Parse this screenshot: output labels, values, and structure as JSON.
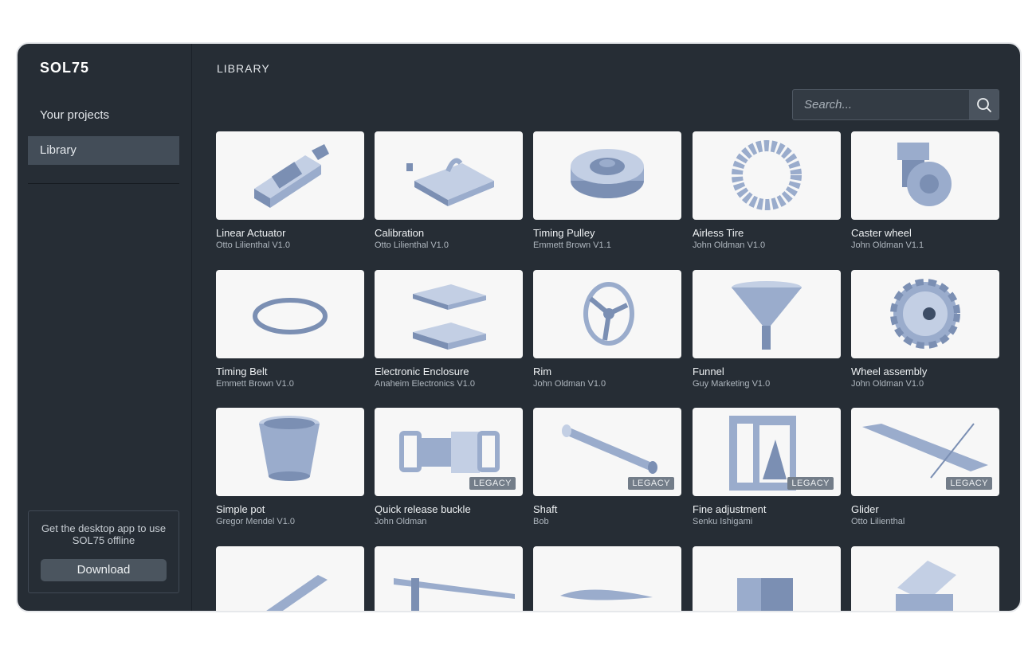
{
  "app": {
    "logo_text": "SOL75",
    "page_title": "LIBRARY",
    "colors": {
      "frame": "#262d35",
      "card": "#f7f7f7",
      "part": "#9aaccc",
      "active_nav": "#434d58",
      "badge": "#737d89"
    }
  },
  "sidebar": {
    "items": [
      {
        "label": "Your projects",
        "active": false
      },
      {
        "label": "Library",
        "active": true
      }
    ],
    "promo": {
      "text": "Get the desktop app to use SOL75 offline",
      "button": "Download"
    }
  },
  "search": {
    "placeholder": "Search...",
    "icon": "magnifier-icon"
  },
  "cards": [
    {
      "title": "Linear Actuator",
      "subtitle": "Otto Lilienthal V1.0",
      "legacy": "",
      "icon": "linear-actuator"
    },
    {
      "title": "Calibration",
      "subtitle": "Otto Lilienthal V1.0",
      "legacy": "",
      "icon": "calibration"
    },
    {
      "title": "Timing Pulley",
      "subtitle": "Emmett Brown V1.1",
      "legacy": "",
      "icon": "timing-pulley"
    },
    {
      "title": "Airless Tire",
      "subtitle": "John Oldman V1.0",
      "legacy": "",
      "icon": "airless-tire"
    },
    {
      "title": "Caster wheel",
      "subtitle": "John Oldman V1.1",
      "legacy": "",
      "icon": "caster-wheel"
    },
    {
      "title": "Timing Belt",
      "subtitle": "Emmett Brown V1.0",
      "legacy": "",
      "icon": "timing-belt"
    },
    {
      "title": "Electronic Enclosure",
      "subtitle": "Anaheim Electronics V1.0",
      "legacy": "",
      "icon": "enclosure"
    },
    {
      "title": "Rim",
      "subtitle": "John Oldman V1.0",
      "legacy": "",
      "icon": "rim"
    },
    {
      "title": "Funnel",
      "subtitle": "Guy Marketing V1.0",
      "legacy": "",
      "icon": "funnel"
    },
    {
      "title": "Wheel assembly",
      "subtitle": "John Oldman V1.0",
      "legacy": "",
      "icon": "wheel-assembly"
    },
    {
      "title": "Simple pot",
      "subtitle": "Gregor Mendel V1.0",
      "legacy": "",
      "icon": "pot"
    },
    {
      "title": "Quick release buckle",
      "subtitle": "John Oldman",
      "legacy": "LEGACY",
      "icon": "buckle"
    },
    {
      "title": "Shaft",
      "subtitle": "Bob",
      "legacy": "LEGACY",
      "icon": "shaft"
    },
    {
      "title": "Fine adjustment",
      "subtitle": "Senku Ishigami",
      "legacy": "LEGACY",
      "icon": "fine-adjustment"
    },
    {
      "title": "Glider",
      "subtitle": "Otto Lilienthal",
      "legacy": "LEGACY",
      "icon": "glider"
    },
    {
      "title": "",
      "subtitle": "",
      "legacy": "",
      "icon": "bracket"
    },
    {
      "title": "",
      "subtitle": "",
      "legacy": "",
      "icon": "truss"
    },
    {
      "title": "",
      "subtitle": "",
      "legacy": "",
      "icon": "airfoil"
    },
    {
      "title": "",
      "subtitle": "",
      "legacy": "",
      "icon": "clamp"
    },
    {
      "title": "",
      "subtitle": "",
      "legacy": "",
      "icon": "box-lid"
    }
  ]
}
